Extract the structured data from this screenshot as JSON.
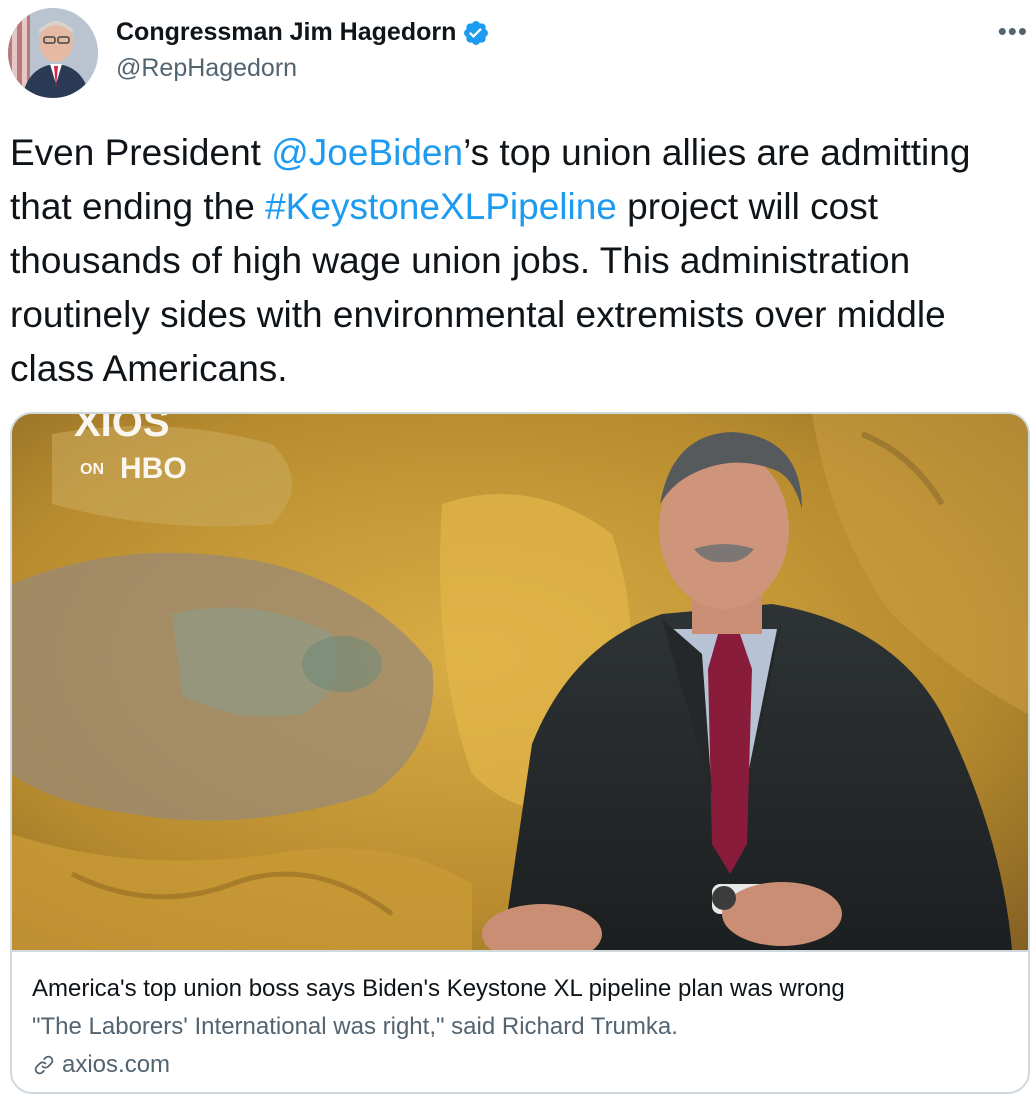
{
  "author": {
    "display_name": "Congressman Jim Hagedorn",
    "handle": "@RepHagedorn",
    "verified": true,
    "avatar_icon": "avatar-photo"
  },
  "more_label": "•••",
  "tweet": {
    "segments": [
      {
        "text": "Even President ",
        "type": "text"
      },
      {
        "text": "@JoeBiden",
        "type": "mention"
      },
      {
        "text": "’s top union allies are admitting that ending the ",
        "type": "text"
      },
      {
        "text": "#KeystoneXLPipeline",
        "type": "hashtag"
      },
      {
        "text": " project will cost thousands of high wage union jobs. This administration routinely sides with environmental extremists over middle class Americans.",
        "type": "text"
      }
    ]
  },
  "card": {
    "image_watermark_top": "XIOS",
    "image_watermark_on": "ON",
    "image_watermark_hbo": "HBO",
    "title": "America's top union boss says Biden's Keystone XL pipeline plan was wrong",
    "description": "\"The Laborers' International was right,\" said Richard Trumka.",
    "domain": "axios.com"
  },
  "colors": {
    "link": "#1d9bf0",
    "text": "#0f1419",
    "secondary": "#536471",
    "border": "#cfd9de"
  }
}
